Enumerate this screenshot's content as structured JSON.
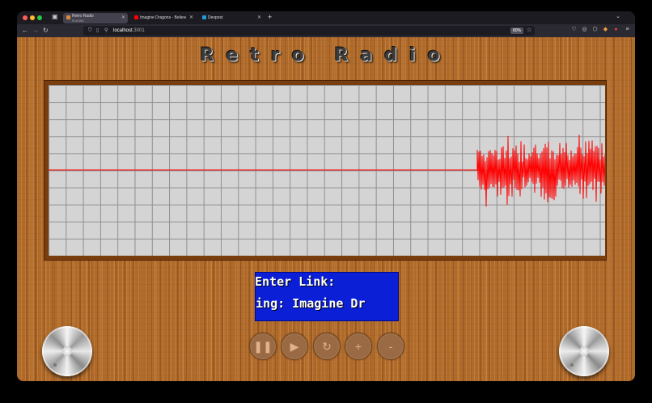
{
  "browser": {
    "tabs": [
      {
        "title": "Retro Radio",
        "subtitle": "PLAYING",
        "active": true,
        "favicon_color": "#d98c3a"
      },
      {
        "title": "Imagine Dragons - Believer (lyric",
        "subtitle": "",
        "active": false,
        "favicon_color": "#ff0000"
      },
      {
        "title": "Devpost",
        "subtitle": "",
        "active": false,
        "favicon_color": "#003e54"
      }
    ],
    "new_tab_icon": "plus-icon",
    "address": {
      "host": "localhost",
      "port": ":3001"
    },
    "zoom": "80%"
  },
  "app": {
    "title": "Retro Radio",
    "display": {
      "line1": "Enter Link:",
      "line2": "ying: Imagine Dr"
    },
    "controls": [
      {
        "name": "pause-button",
        "icon": "pause-icon",
        "glyph": "⏸"
      },
      {
        "name": "play-button",
        "icon": "play-icon",
        "glyph": "▶"
      },
      {
        "name": "replay-button",
        "icon": "replay-icon",
        "glyph": "↻"
      },
      {
        "name": "volume-up-button",
        "icon": "plus-icon",
        "glyph": "+"
      },
      {
        "name": "volume-down-button",
        "icon": "minus-icon",
        "glyph": "-"
      }
    ],
    "colors": {
      "wood": "#b06a2a",
      "lcd_background": "#0a1fd6",
      "waveform": "#ff0000",
      "scope_background": "#d4d4d4"
    }
  }
}
